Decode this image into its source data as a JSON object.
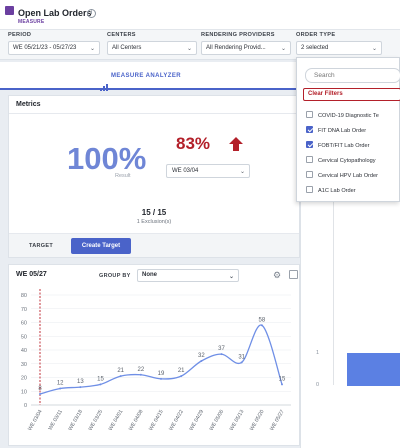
{
  "header": {
    "title": "Open Lab Orders",
    "subtitle": "MEASURE",
    "info_icon": "info-icon"
  },
  "filters": {
    "period": {
      "label": "PERIOD",
      "value": "WE 05/21/23 - 05/27/23"
    },
    "centers": {
      "label": "CENTERS",
      "value": "All Centers"
    },
    "providers": {
      "label": "RENDERING PROVIDERS",
      "value": "All Rendering Provid..."
    },
    "order_type": {
      "label": "ORDER TYPE",
      "value": "2 selected"
    }
  },
  "analyzer": {
    "label": "MEASURE ANALYZER",
    "icon": "bar-chart-icon"
  },
  "metrics": {
    "title": "Metrics",
    "result_value": "100%",
    "result_caption": "Result",
    "compare_value": "83%",
    "compare_icon": "arrow-up-icon",
    "compare_week": "WE 03/04",
    "ratio": "15 / 15",
    "exclusions": "1 Exclusion(s)",
    "target_label": "TARGET",
    "create_target": "Create Target"
  },
  "chart_header": {
    "week": "WE 05/27",
    "group_by_label": "GROUP BY",
    "group_by_value": "None"
  },
  "order_type_dropdown": {
    "search_placeholder": "Search",
    "clear_label": "Clear Filters",
    "options": [
      {
        "label": "COVID-19 Diagnostic Te",
        "checked": false
      },
      {
        "label": "FIT DNA Lab Order",
        "checked": true
      },
      {
        "label": "FOBT/FIT Lab Order",
        "checked": true
      },
      {
        "label": "Cervical Cytopathology",
        "checked": false
      },
      {
        "label": "Cervical HPV Lab Order",
        "checked": false
      },
      {
        "label": "A1C Lab Order",
        "checked": false
      }
    ]
  },
  "right_axis": {
    "ticks": [
      "1",
      "0"
    ]
  },
  "colors": {
    "accent": "#4a63c9",
    "negative": "#b3202a",
    "line": "#6f8fe6",
    "marker": "#c0303a"
  },
  "chart_data": {
    "type": "line",
    "x": [
      "WE 03/04",
      "WE 03/11",
      "WE 03/18",
      "WE 03/25",
      "WE 04/01",
      "WE 04/08",
      "WE 04/15",
      "WE 04/22",
      "WE 04/29",
      "WE 05/06",
      "WE 05/13",
      "WE 05/20",
      "WE 05/27"
    ],
    "series": [
      {
        "values": [
          8,
          12,
          13,
          15,
          21,
          22,
          19,
          21,
          32,
          37,
          31,
          58,
          15
        ]
      }
    ],
    "ylim": [
      0,
      80
    ],
    "yticks": [
      0,
      10,
      20,
      30,
      40,
      50,
      60,
      70,
      80
    ],
    "grid": true,
    "marker_category": "WE 03/04"
  }
}
